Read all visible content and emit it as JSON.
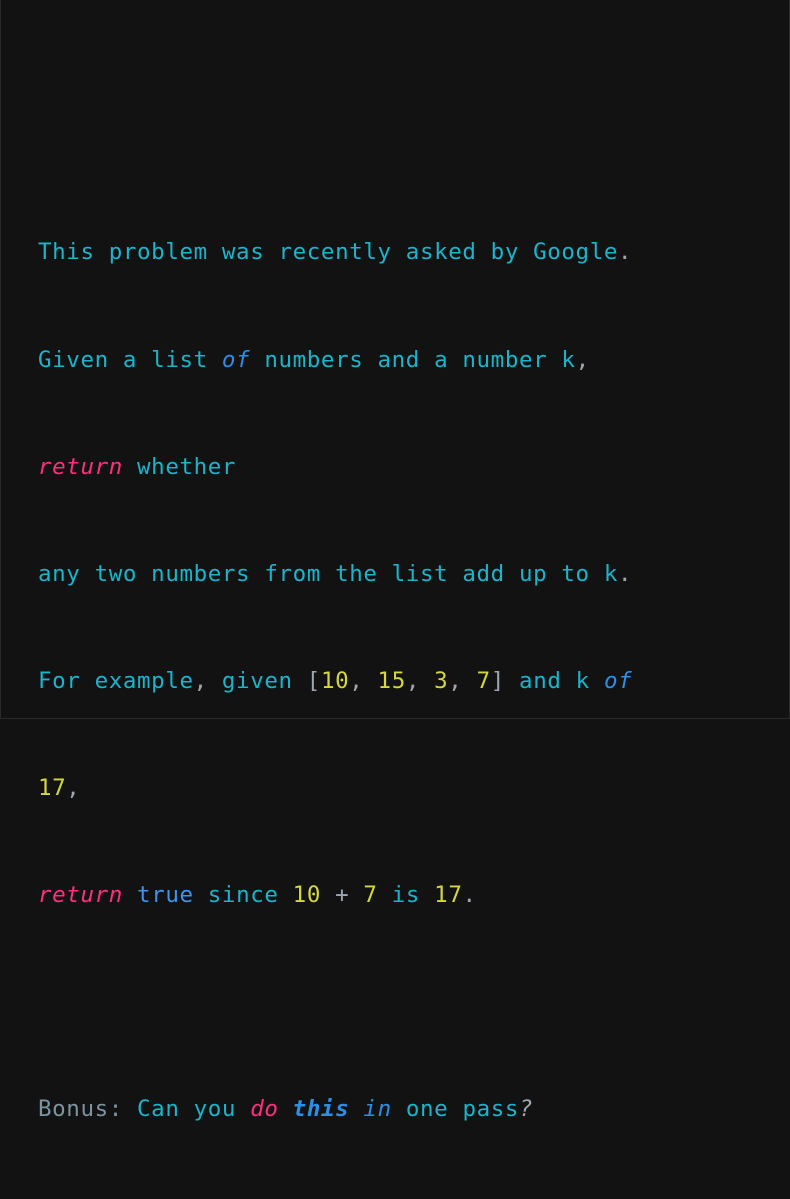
{
  "colors": {
    "background": "#121212",
    "text": "#18b5cc",
    "keyword_pink": "#ff2e7e",
    "keyword_blue": "#2b8fe8",
    "number": "#d4d83a",
    "punctuation": "#9ea7b1",
    "comment": "#7e93a0"
  },
  "lines": [
    {
      "t1": "This problem was recently asked by Google",
      "t2": "."
    },
    {
      "t1": "Given a list ",
      "kw": "of",
      "t2": " numbers and a number k",
      "t3": ","
    },
    {
      "kw": "return",
      "t1": " whether"
    },
    {
      "t1": "any two numbers from the list add up to k",
      "t2": "."
    },
    {
      "t1": "For example",
      "p1": ",",
      "t2": " given ",
      "b1": "[",
      "n1": "10",
      "p2": ", ",
      "n2": "15",
      "p3": ", ",
      "n3": "3",
      "p4": ", ",
      "n4": "7",
      "b2": "]",
      "t3": " and k ",
      "kw": "of"
    },
    {
      "n1": "17",
      "p1": ","
    },
    {
      "kw": "return",
      "t1": " ",
      "kt": "true",
      "t2": " since ",
      "n1": "10",
      "op": " + ",
      "n2": "7",
      "t3": " is ",
      "n3": "17",
      "p1": "."
    },
    {},
    {
      "c1": "Bonus:",
      "t1": " Can you ",
      "kw1": "do",
      "t2": " ",
      "kw2": "this",
      "t3": " ",
      "kw3": "in",
      "t4": " one pass",
      "p1": "?"
    }
  ]
}
